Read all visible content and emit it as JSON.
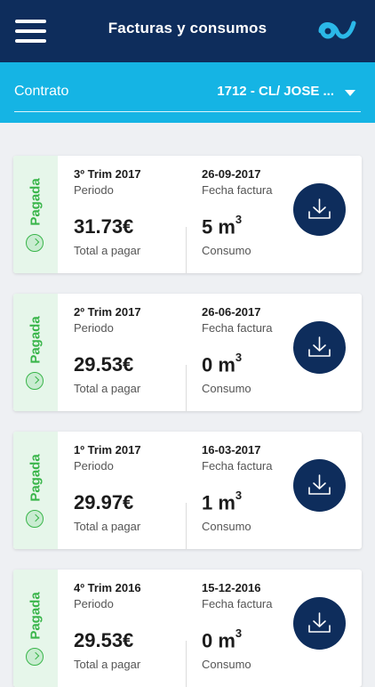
{
  "header": {
    "title": "Facturas y consumos",
    "menu_icon": "menu-icon",
    "logo_icon": "brand-logo-icon"
  },
  "contract": {
    "label": "Contrato",
    "value": "1712 - CL/ JOSE ..."
  },
  "colors": {
    "navy": "#0e2d5c",
    "cyan": "#15b4e4",
    "paid_green": "#39b54a",
    "paid_bg": "#e6f6ea"
  },
  "invoices": [
    {
      "status": "Pagada",
      "period": "3º Trim 2017",
      "period_label": "Periodo",
      "amount": "31.73€",
      "amount_label": "Total a pagar",
      "date": "26-09-2017",
      "date_label": "Fecha factura",
      "consumo_value": "5 m",
      "consumo_unit_sup": "3",
      "consumo_label": "Consumo"
    },
    {
      "status": "Pagada",
      "period": "2º Trim 2017",
      "period_label": "Periodo",
      "amount": "29.53€",
      "amount_label": "Total a pagar",
      "date": "26-06-2017",
      "date_label": "Fecha factura",
      "consumo_value": "0 m",
      "consumo_unit_sup": "3",
      "consumo_label": "Consumo"
    },
    {
      "status": "Pagada",
      "period": "1º Trim 2017",
      "period_label": "Periodo",
      "amount": "29.97€",
      "amount_label": "Total a pagar",
      "date": "16-03-2017",
      "date_label": "Fecha factura",
      "consumo_value": "1 m",
      "consumo_unit_sup": "3",
      "consumo_label": "Consumo"
    },
    {
      "status": "Pagada",
      "period": "4º Trim 2016",
      "period_label": "Periodo",
      "amount": "29.53€",
      "amount_label": "Total a pagar",
      "date": "15-12-2016",
      "date_label": "Fecha factura",
      "consumo_value": "0 m",
      "consumo_unit_sup": "3",
      "consumo_label": "Consumo"
    }
  ]
}
